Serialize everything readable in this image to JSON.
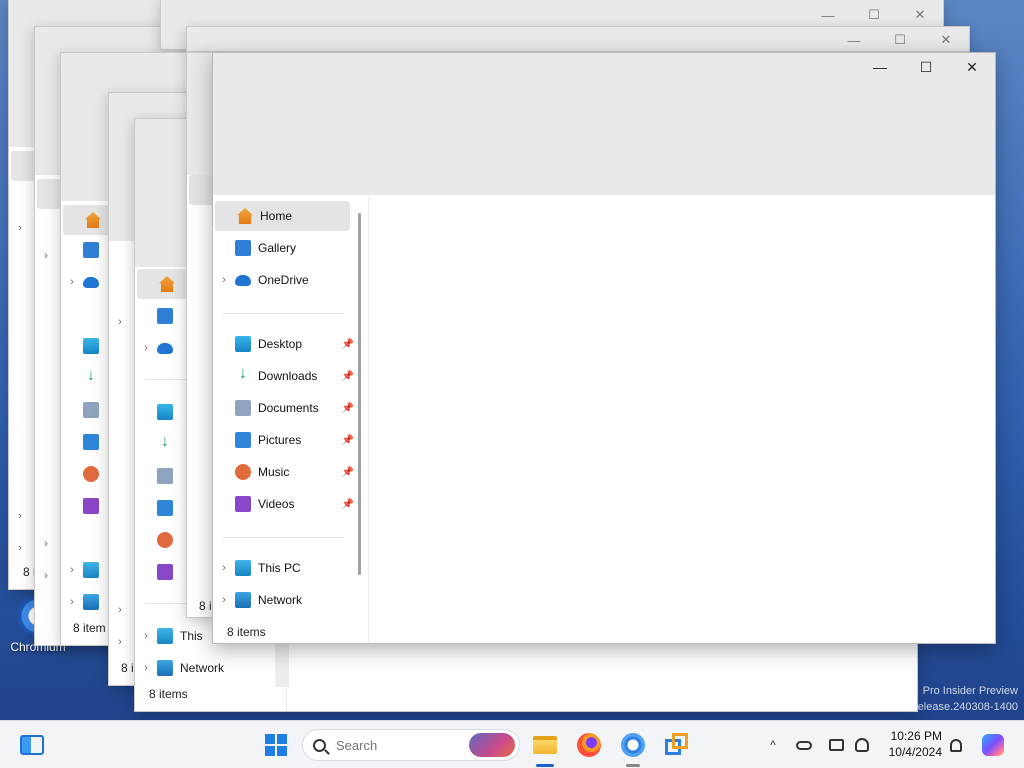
{
  "desktop": {
    "icon_label": "Chromium",
    "watermark_line1": "Pro Insider Preview",
    "watermark_line2": "elease.240308-1400"
  },
  "window": {
    "caption": {
      "minimize": "—",
      "maximize": "☐",
      "close": "✕"
    },
    "nav": {
      "home": "Home",
      "gallery": "Gallery",
      "onedrive": "OneDrive",
      "desktop": "Desktop",
      "downloads": "Downloads",
      "documents": "Documents",
      "pictures": "Pictures",
      "music": "Music",
      "videos": "Videos",
      "thispc": "This PC",
      "network": "Network",
      "bg_thispc": "This",
      "pin": "📌",
      "chevron": "›"
    },
    "status": "8 items",
    "status_truncated_a": "8 i",
    "status_truncated_b": "8 item"
  },
  "taskbar": {
    "search_placeholder": "Search",
    "clock_time": "10:26 PM",
    "clock_date": "10/4/2024",
    "tray_chevron": "^"
  }
}
